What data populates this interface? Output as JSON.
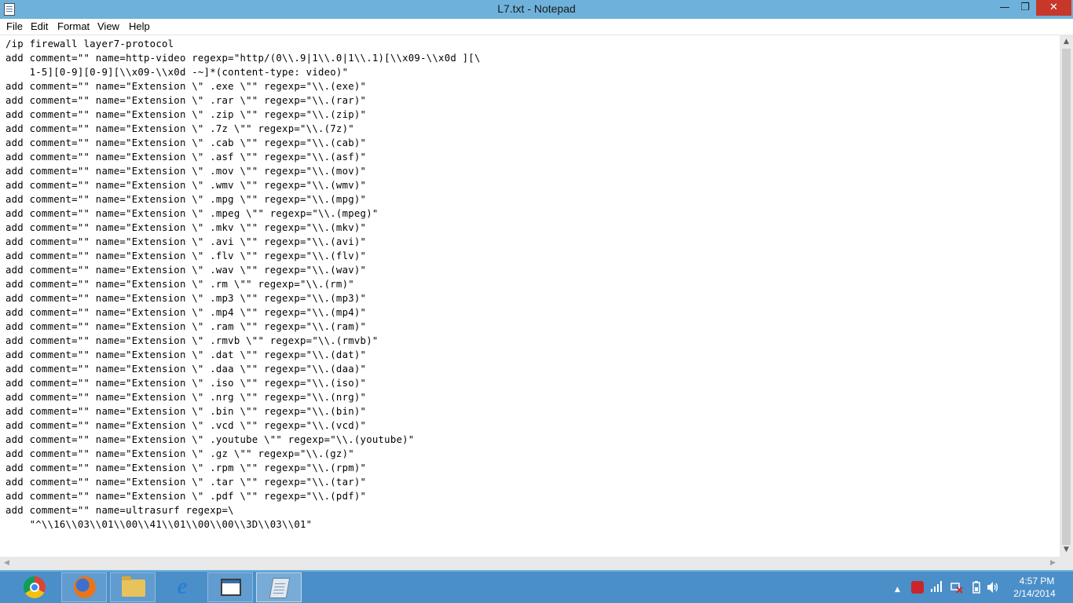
{
  "window": {
    "title": "L7.txt - Notepad",
    "minimize_glyph": "—",
    "maximize_glyph": "❐",
    "close_glyph": "✕"
  },
  "menu": {
    "file": "File",
    "edit": "Edit",
    "format": "Format",
    "view": "View",
    "help": "Help"
  },
  "document": {
    "lines": [
      "/ip firewall layer7-protocol",
      "add comment=\"\" name=http-video regexp=\"http/(0\\\\.9|1\\\\.0|1\\\\.1)[\\\\x09-\\\\x0d ][\\",
      "    1-5][0-9][0-9][\\\\x09-\\\\x0d -~]*(content-type: video)\"",
      "add comment=\"\" name=\"Extension \\\" .exe \\\"\" regexp=\"\\\\.(exe)\"",
      "add comment=\"\" name=\"Extension \\\" .rar \\\"\" regexp=\"\\\\.(rar)\"",
      "add comment=\"\" name=\"Extension \\\" .zip \\\"\" regexp=\"\\\\.(zip)\"",
      "add comment=\"\" name=\"Extension \\\" .7z \\\"\" regexp=\"\\\\.(7z)\"",
      "add comment=\"\" name=\"Extension \\\" .cab \\\"\" regexp=\"\\\\.(cab)\"",
      "add comment=\"\" name=\"Extension \\\" .asf \\\"\" regexp=\"\\\\.(asf)\"",
      "add comment=\"\" name=\"Extension \\\" .mov \\\"\" regexp=\"\\\\.(mov)\"",
      "add comment=\"\" name=\"Extension \\\" .wmv \\\"\" regexp=\"\\\\.(wmv)\"",
      "add comment=\"\" name=\"Extension \\\" .mpg \\\"\" regexp=\"\\\\.(mpg)\"",
      "add comment=\"\" name=\"Extension \\\" .mpeg \\\"\" regexp=\"\\\\.(mpeg)\"",
      "add comment=\"\" name=\"Extension \\\" .mkv \\\"\" regexp=\"\\\\.(mkv)\"",
      "add comment=\"\" name=\"Extension \\\" .avi \\\"\" regexp=\"\\\\.(avi)\"",
      "add comment=\"\" name=\"Extension \\\" .flv \\\"\" regexp=\"\\\\.(flv)\"",
      "add comment=\"\" name=\"Extension \\\" .wav \\\"\" regexp=\"\\\\.(wav)\"",
      "add comment=\"\" name=\"Extension \\\" .rm \\\"\" regexp=\"\\\\.(rm)\"",
      "add comment=\"\" name=\"Extension \\\" .mp3 \\\"\" regexp=\"\\\\.(mp3)\"",
      "add comment=\"\" name=\"Extension \\\" .mp4 \\\"\" regexp=\"\\\\.(mp4)\"",
      "add comment=\"\" name=\"Extension \\\" .ram \\\"\" regexp=\"\\\\.(ram)\"",
      "add comment=\"\" name=\"Extension \\\" .rmvb \\\"\" regexp=\"\\\\.(rmvb)\"",
      "add comment=\"\" name=\"Extension \\\" .dat \\\"\" regexp=\"\\\\.(dat)\"",
      "add comment=\"\" name=\"Extension \\\" .daa \\\"\" regexp=\"\\\\.(daa)\"",
      "add comment=\"\" name=\"Extension \\\" .iso \\\"\" regexp=\"\\\\.(iso)\"",
      "add comment=\"\" name=\"Extension \\\" .nrg \\\"\" regexp=\"\\\\.(nrg)\"",
      "add comment=\"\" name=\"Extension \\\" .bin \\\"\" regexp=\"\\\\.(bin)\"",
      "add comment=\"\" name=\"Extension \\\" .vcd \\\"\" regexp=\"\\\\.(vcd)\"",
      "add comment=\"\" name=\"Extension \\\" .youtube \\\"\" regexp=\"\\\\.(youtube)\"",
      "add comment=\"\" name=\"Extension \\\" .gz \\\"\" regexp=\"\\\\.(gz)\"",
      "add comment=\"\" name=\"Extension \\\" .rpm \\\"\" regexp=\"\\\\.(rpm)\"",
      "add comment=\"\" name=\"Extension \\\" .tar \\\"\" regexp=\"\\\\.(tar)\"",
      "add comment=\"\" name=\"Extension \\\" .pdf \\\"\" regexp=\"\\\\.(pdf)\"",
      "add comment=\"\" name=ultrasurf regexp=\\",
      "    \"^\\\\16\\\\03\\\\01\\\\00\\\\41\\\\01\\\\00\\\\00\\\\3D\\\\03\\\\01\""
    ]
  },
  "taskbar": {
    "apps": [
      {
        "name": "chrome-icon"
      },
      {
        "name": "firefox-icon"
      },
      {
        "name": "file-explorer-icon"
      },
      {
        "name": "internet-explorer-icon"
      },
      {
        "name": "window-app-icon"
      },
      {
        "name": "notepad-icon"
      }
    ],
    "ie_glyph": "e"
  },
  "tray": {
    "show_hidden_glyph": "▲",
    "clock_time": "4:57 PM",
    "clock_date": "2/14/2014"
  },
  "colors": {
    "titlebar": "#6eb2dc",
    "taskbar": "#4b8fc9",
    "close_button": "#c7382a"
  }
}
